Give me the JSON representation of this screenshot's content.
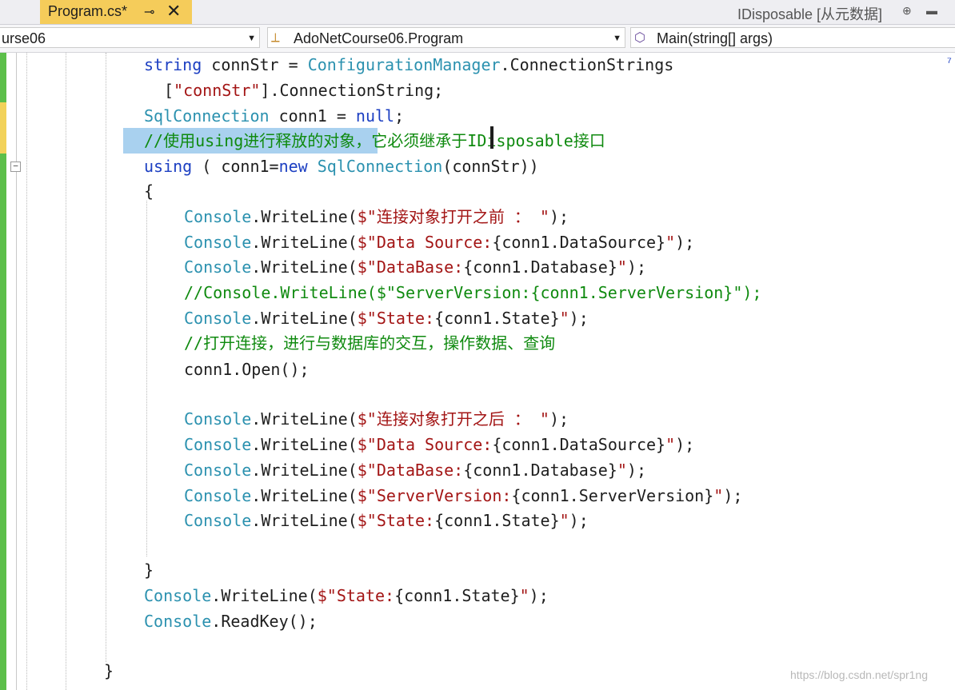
{
  "tabs": {
    "active_title": "Program.cs*",
    "pin_glyph": "⊸",
    "close_glyph": "✕",
    "right_tab_title": "IDisposable [从元数据]",
    "right_pin_glyph": "⊕",
    "right_btn_glyph": "▬"
  },
  "nav": {
    "project": "urse06",
    "class": "AdoNetCourse06.Program",
    "member": "Main(string[] args)",
    "dropdown_arrow": "▼",
    "class_icon_glyph": "⟂",
    "member_icon_glyph": "⬡"
  },
  "editor": {
    "collapse_glyph": "−",
    "scroll_mark": "⁷",
    "lines": [
      {
        "kw1": "string",
        "t1": " connStr = ",
        "ty1": "ConfigurationManager",
        "t2": ".ConnectionStrings"
      },
      {
        "t1": "[",
        "st1": "\"connStr\"",
        "t2": "].ConnectionString;"
      },
      {
        "ty1": "SqlConnection",
        "t1": " conn1 = ",
        "kw1": "null",
        "t2": ";"
      },
      {
        "cm1": "//使用using进行释放的对象，它必须继承于IDisposable接口"
      },
      {
        "kw1": "using",
        "t1": " ( conn1=",
        "kw2": "new",
        "t2": " ",
        "ty1": "SqlConnection",
        "t3": "(connStr))"
      },
      {
        "t1": "{"
      },
      {
        "ty1": "Console",
        "t1": ".WriteLine(",
        "st1": "$\"连接对象打开之前 ： \"",
        "t2": ");"
      },
      {
        "ty1": "Console",
        "t1": ".WriteLine(",
        "st1": "$\"Data Source:",
        "t2": "{conn1.DataSource}",
        "st2": "\"",
        "t3": ");"
      },
      {
        "ty1": "Console",
        "t1": ".WriteLine(",
        "st1": "$\"DataBase:",
        "t2": "{conn1.Database}",
        "st2": "\"",
        "t3": ");"
      },
      {
        "cm1": "//Console.WriteLine($\"ServerVersion:{conn1.ServerVersion}\");"
      },
      {
        "ty1": "Console",
        "t1": ".WriteLine(",
        "st1": "$\"State:",
        "t2": "{conn1.State}",
        "st2": "\"",
        "t3": ");"
      },
      {
        "cm1": "//打开连接，进行与数据库的交互，操作数据、查询"
      },
      {
        "t1": "conn1.Open();"
      },
      {
        "ty1": "Console",
        "t1": ".WriteLine(",
        "st1": "$\"连接对象打开之后 ： \"",
        "t2": ");"
      },
      {
        "ty1": "Console",
        "t1": ".WriteLine(",
        "st1": "$\"Data Source:",
        "t2": "{conn1.DataSource}",
        "st2": "\"",
        "t3": ");"
      },
      {
        "ty1": "Console",
        "t1": ".WriteLine(",
        "st1": "$\"DataBase:",
        "t2": "{conn1.Database}",
        "st2": "\"",
        "t3": ");"
      },
      {
        "ty1": "Console",
        "t1": ".WriteLine(",
        "st1": "$\"ServerVersion:",
        "t2": "{conn1.ServerVersion}",
        "st2": "\"",
        "t3": ");"
      },
      {
        "ty1": "Console",
        "t1": ".WriteLine(",
        "st1": "$\"State:",
        "t2": "{conn1.State}",
        "st2": "\"",
        "t3": ");"
      },
      {
        "t1": "}"
      },
      {
        "ty1": "Console",
        "t1": ".WriteLine(",
        "st1": "$\"State:",
        "t2": "{conn1.State}",
        "st2": "\"",
        "t3": ");"
      },
      {
        "ty1": "Console",
        "t1": ".ReadKey();"
      },
      {
        "t1": "}"
      }
    ]
  },
  "watermark": "https://blog.csdn.net/spr1ng"
}
